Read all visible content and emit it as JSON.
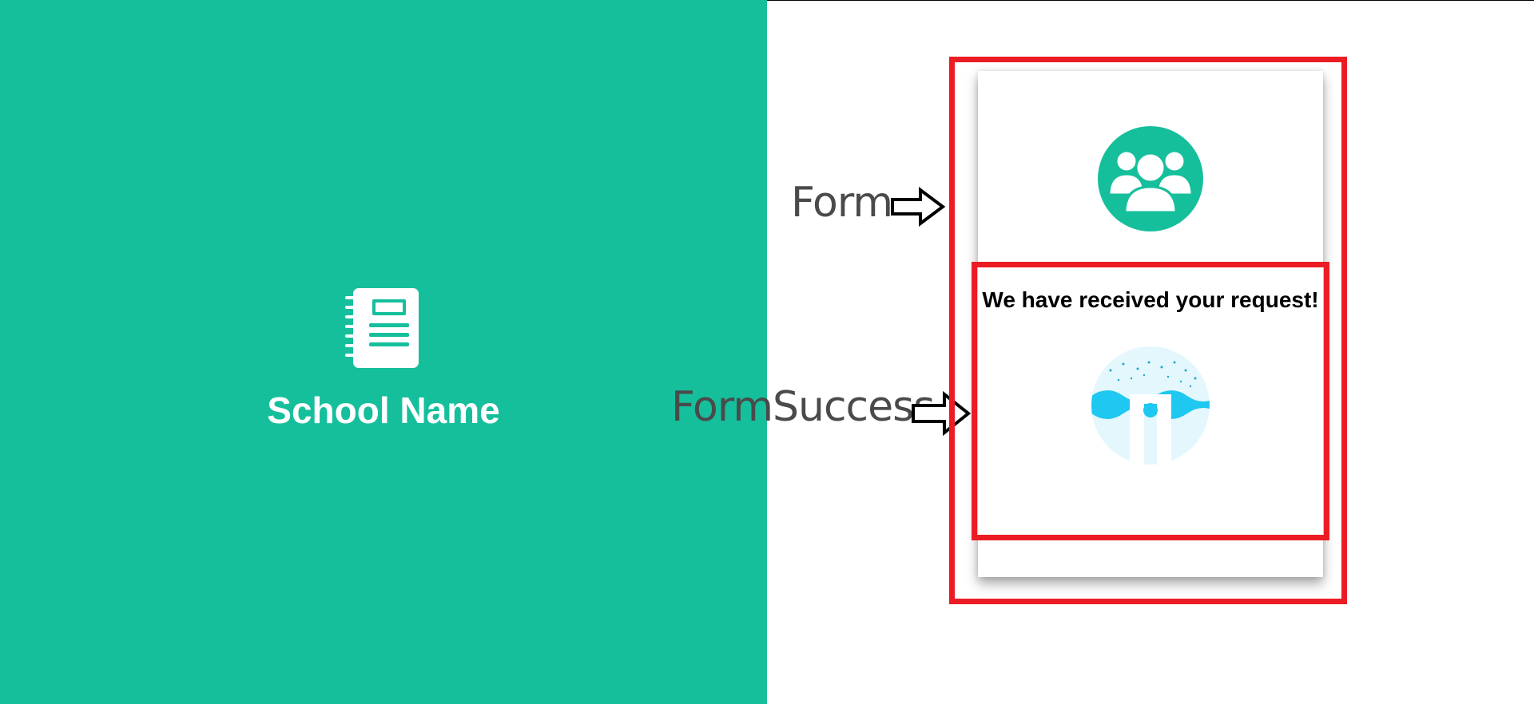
{
  "brand": {
    "icon": "notebook-icon",
    "school_name": "School Name"
  },
  "annotations": {
    "form_label": "Form",
    "form_success_label": "FormSuccess",
    "arrow_icon": "right-arrow-icon"
  },
  "form": {
    "icon": "users-icon",
    "success_message": "We have received your request!",
    "success_illustration": "success-illustration"
  },
  "colors": {
    "accent": "#16bf9c",
    "highlight_border": "#ec1c24",
    "label_text": "#4a4a4a",
    "illustration_blue": "#1ec8f0"
  }
}
